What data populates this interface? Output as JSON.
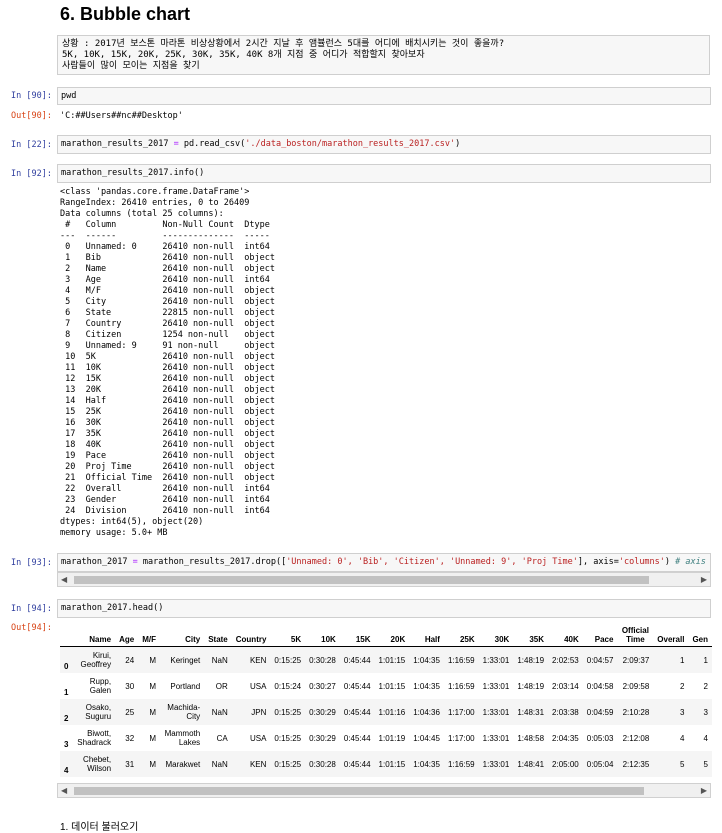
{
  "heading": "6. Bubble chart",
  "markdown": {
    "line1": "상황 : 2017년 보스톤 마라톤 비상상황에서 2시간 지날 후 앰뷸런스 5대를 어디에 배치시키는 것이 좋을까?",
    "line2": "5K, 10K, 15K, 20K, 25K, 30K, 35K, 40K 8개 지점 중 어디가 적합할지 찾아보자",
    "line3": "사람들이 많이 모이는 지점을 찾기"
  },
  "cells": {
    "c90": {
      "in_prompt": "In [90]:",
      "code": "pwd",
      "out_prompt": "Out[90]:",
      "output": "'C:##Users##nc##Desktop'"
    },
    "c22": {
      "in_prompt": "In [22]:",
      "code_a": "marathon_results_2017 ",
      "code_op": "=",
      "code_b": " pd.read_csv(",
      "code_str": "'./data_boston/marathon_results_2017.csv'",
      "code_c": ")"
    },
    "c92": {
      "in_prompt": "In [92]:",
      "code": "marathon_results_2017.info()",
      "output": [
        "<class 'pandas.core.frame.DataFrame'>",
        "RangeIndex: 26410 entries, 0 to 26409",
        "Data columns (total 25 columns):",
        " #   Column         Non-Null Count  Dtype",
        "---  ------         --------------  -----",
        " 0   Unnamed: 0     26410 non-null  int64",
        " 1   Bib            26410 non-null  object",
        " 2   Name           26410 non-null  object",
        " 3   Age            26410 non-null  int64",
        " 4   M/F            26410 non-null  object",
        " 5   City           26410 non-null  object",
        " 6   State          22815 non-null  object",
        " 7   Country        26410 non-null  object",
        " 8   Citizen        1254 non-null   object",
        " 9   Unnamed: 9     91 non-null     object",
        " 10  5K             26410 non-null  object",
        " 11  10K            26410 non-null  object",
        " 12  15K            26410 non-null  object",
        " 13  20K            26410 non-null  object",
        " 14  Half           26410 non-null  object",
        " 15  25K            26410 non-null  object",
        " 16  30K            26410 non-null  object",
        " 17  35K            26410 non-null  object",
        " 18  40K            26410 non-null  object",
        " 19  Pace           26410 non-null  object",
        " 20  Proj Time      26410 non-null  object",
        " 21  Official Time  26410 non-null  object",
        " 22  Overall        26410 non-null  int64",
        " 23  Gender         26410 non-null  int64",
        " 24  Division       26410 non-null  int64",
        "dtypes: int64(5), object(20)",
        "memory usage: 5.0+ MB"
      ]
    },
    "c93": {
      "in_prompt": "In [93]:",
      "code_a": "marathon_2017 ",
      "code_op": "=",
      "code_b": " marathon_results_2017.drop([",
      "code_str": "'Unnamed: 0', 'Bib', 'Citizen', 'Unnamed: 9', 'Proj Time'",
      "code_c": "], axis=",
      "code_str2": "'columns'",
      "code_d": ") ",
      "code_cm": "# axis 문자로도 가능"
    },
    "c94": {
      "in_prompt": "In [94]:",
      "code": "marathon_2017.head()",
      "out_prompt": "Out[94]:"
    }
  },
  "dataframe": {
    "columns": [
      "",
      "Name",
      "Age",
      "M/F",
      "City",
      "State",
      "Country",
      "5K",
      "10K",
      "15K",
      "20K",
      "Half",
      "25K",
      "30K",
      "35K",
      "40K",
      "Pace",
      "Official Time",
      "Overall",
      "Gen"
    ],
    "rows": [
      [
        "0",
        "Kirui, Geoffrey",
        "24",
        "M",
        "Keringet",
        "NaN",
        "KEN",
        "0:15:25",
        "0:30:28",
        "0:45:44",
        "1:01:15",
        "1:04:35",
        "1:16:59",
        "1:33:01",
        "1:48:19",
        "2:02:53",
        "0:04:57",
        "2:09:37",
        "1",
        "1"
      ],
      [
        "1",
        "Rupp, Galen",
        "30",
        "M",
        "Portland",
        "OR",
        "USA",
        "0:15:24",
        "0:30:27",
        "0:45:44",
        "1:01:15",
        "1:04:35",
        "1:16:59",
        "1:33:01",
        "1:48:19",
        "2:03:14",
        "0:04:58",
        "2:09:58",
        "2",
        "2"
      ],
      [
        "2",
        "Osako, Suguru",
        "25",
        "M",
        "Machida-City",
        "NaN",
        "JPN",
        "0:15:25",
        "0:30:29",
        "0:45:44",
        "1:01:16",
        "1:04:36",
        "1:17:00",
        "1:33:01",
        "1:48:31",
        "2:03:38",
        "0:04:59",
        "2:10:28",
        "3",
        "3"
      ],
      [
        "3",
        "Biwott, Shadrack",
        "32",
        "M",
        "Mammoth Lakes",
        "CA",
        "USA",
        "0:15:25",
        "0:30:29",
        "0:45:44",
        "1:01:19",
        "1:04:45",
        "1:17:00",
        "1:33:01",
        "1:48:58",
        "2:04:35",
        "0:05:03",
        "2:12:08",
        "4",
        "4"
      ],
      [
        "4",
        "Chebet, Wilson",
        "31",
        "M",
        "Marakwet",
        "NaN",
        "KEN",
        "0:15:25",
        "0:30:28",
        "0:45:44",
        "1:01:15",
        "1:04:35",
        "1:16:59",
        "1:33:01",
        "1:48:41",
        "2:05:00",
        "0:05:04",
        "2:12:35",
        "5",
        "5"
      ]
    ]
  },
  "next_heading": "1. 데이터 불러오기",
  "icons": {
    "scroll_left": "triangle-left",
    "scroll_right": "triangle-right"
  },
  "colors": {
    "in_prompt": "#303f9f",
    "out_prompt": "#d84315",
    "string": "#ba2121",
    "operator": "#aa22ff",
    "comment": "#408080"
  }
}
